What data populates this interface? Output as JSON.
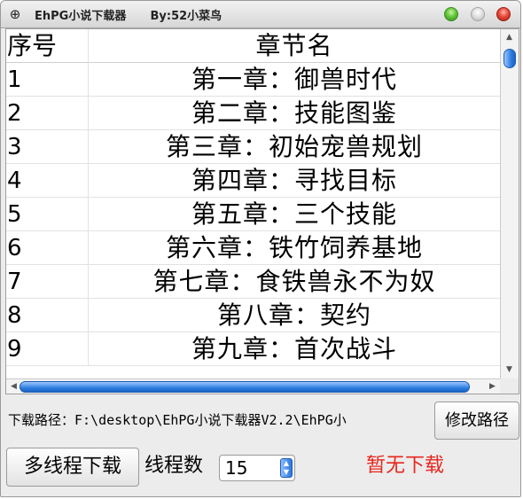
{
  "window": {
    "title": "EhPG小说下载器      By:52小菜鸟",
    "app_icon": "⊕"
  },
  "table": {
    "columns": [
      "序号",
      "章节名"
    ],
    "rows": [
      {
        "no": "1",
        "title": "第一章：御兽时代"
      },
      {
        "no": "2",
        "title": "第二章：技能图鉴"
      },
      {
        "no": "3",
        "title": "第三章：初始宠兽规划"
      },
      {
        "no": "4",
        "title": "第四章：寻找目标"
      },
      {
        "no": "5",
        "title": "第五章：三个技能"
      },
      {
        "no": "6",
        "title": "第六章：铁竹饲养基地"
      },
      {
        "no": "7",
        "title": "第七章：食铁兽永不为奴"
      },
      {
        "no": "8",
        "title": "第八章：契约"
      },
      {
        "no": "9",
        "title": "第九章：首次战斗"
      }
    ]
  },
  "download": {
    "path_label": "下载路径：F:\\desktop\\EhPG小说下载器V2.2\\EhPG小",
    "change_path_button": "修改路径",
    "multi_thread_button": "多线程下载",
    "threads_label": "线程数",
    "threads_value": "15",
    "status": "暂无下载"
  },
  "colors": {
    "status_red": "#e8261e",
    "scroll_blue": "#2e7fe0",
    "light_green": "#63c83a",
    "light_red": "#e8493a"
  }
}
